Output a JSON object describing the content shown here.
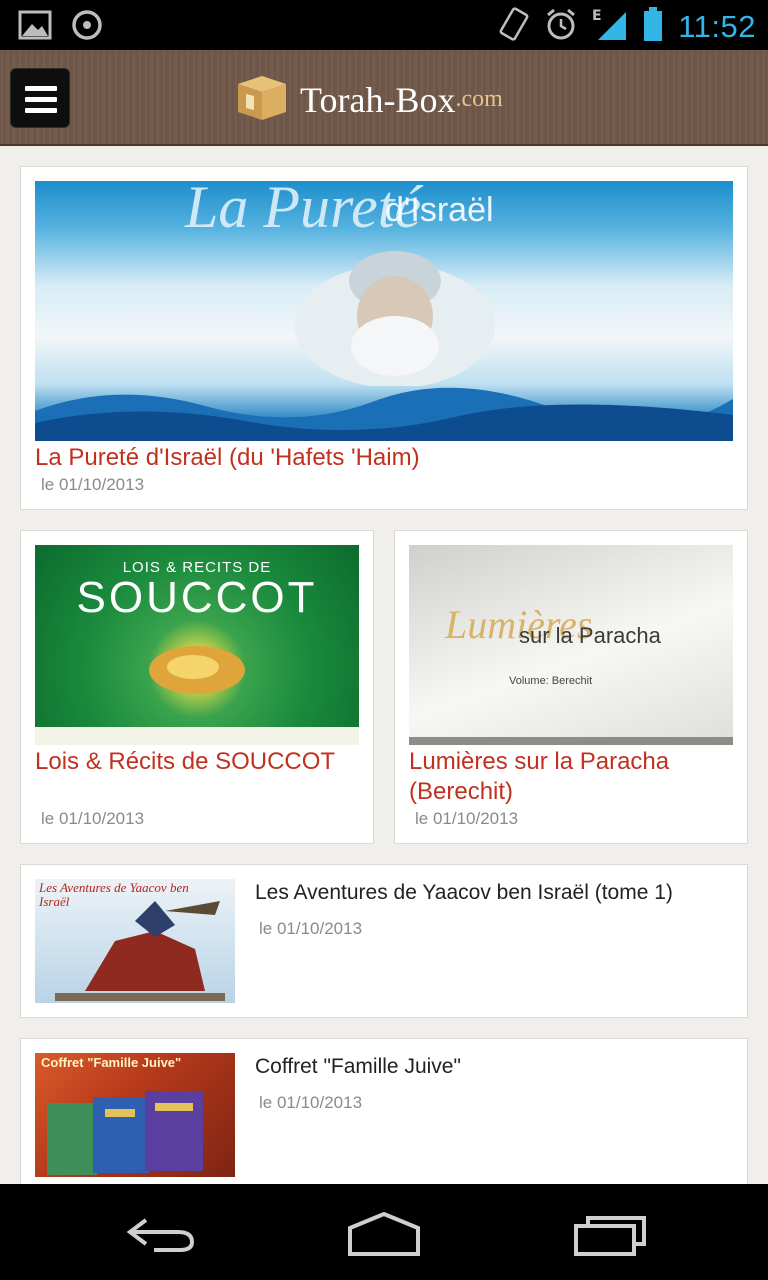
{
  "status_bar": {
    "time": "11:52",
    "network": "E",
    "icons": [
      "image-icon",
      "sync-icon",
      "vibrate-icon",
      "alarm-icon",
      "signal-icon",
      "battery-icon"
    ]
  },
  "header": {
    "logo_text": "Torah-Box",
    "logo_suffix": ".com",
    "menu_icon": "hamburger-menu-icon"
  },
  "featured": {
    "image_alt": "Puret d'Isral cover",
    "image_text_top": "La Pureté",
    "image_text_sub": "d'Israël",
    "title": "La Pureté d'Israël (du 'Hafets 'Haim)",
    "date": "le 01/10/2013"
  },
  "grid": [
    {
      "image_line1": "LOIS & RECITS DE",
      "image_line2": "SOUCCOT",
      "title": "Lois & Récits de SOUCCOT",
      "date": "le 01/10/2013"
    },
    {
      "image_line1": "Lumières",
      "image_line2": "sur la Paracha",
      "image_line3": "Volume: Berechit",
      "title": "Lumières sur la Paracha (Berechit)",
      "date": "le 01/10/2013"
    }
  ],
  "list": [
    {
      "image_text": "Les Aventures de Yaacov ben Israël",
      "title": "Les Aventures de Yaacov ben Israël (tome 1)",
      "date": "le 01/10/2013"
    },
    {
      "image_text": "Coffret \"Famille Juive\"",
      "title": "Coffret \"Famille Juive\"",
      "date": "le 01/10/2013"
    }
  ],
  "nav_bar": {
    "icons": [
      "back-icon",
      "home-icon",
      "recent-apps-icon"
    ]
  },
  "colors": {
    "accent_red": "#c0311e",
    "time_blue": "#33b5e5",
    "header_brown": "#6b5446"
  }
}
